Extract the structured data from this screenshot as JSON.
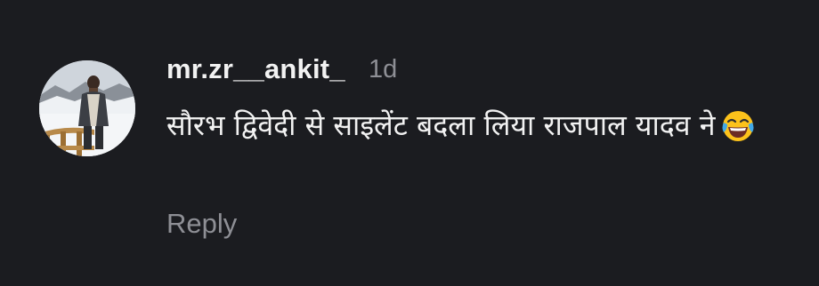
{
  "comment": {
    "username": "mr.zr__ankit_",
    "timestamp": "1d",
    "text": "सौरभ द्विवेदी से साइलेंट बदला लिया राजपाल यादव ने",
    "emoji": "face-with-tears-of-joy",
    "reply_label": "Reply",
    "avatar": "user-avatar-photo"
  },
  "colors": {
    "background": "#1b1c20",
    "primary_text": "#f2f2f2",
    "secondary_text": "#8e8f95"
  }
}
